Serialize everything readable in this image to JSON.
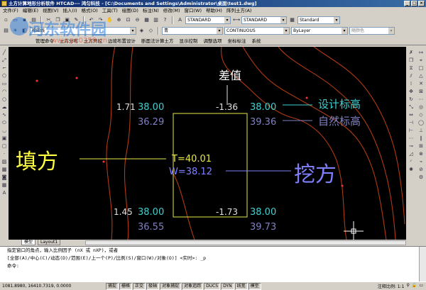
{
  "window": {
    "title": "土方计算地形分析软件 HTCAD--- 鸿匀科技 - [C:\\Documents and Settings\\Administrator\\桌面\\test1.dwg]",
    "controls": [
      "_",
      "□",
      "×"
    ]
  },
  "menu": [
    "文件(F)",
    "编辑(E)",
    "视图(V)",
    "插入(I)",
    "格式(O)",
    "工具(T)",
    "绘图(D)",
    "标注(N)",
    "修改(M)",
    "窗口(W)",
    "帮助(H)",
    "阵列土方(A)"
  ],
  "toolbar": {
    "style_combo": "STANDARD",
    "dim_style_combo": "STANDARD",
    "table_style_combo": "Standard",
    "layer_combo": "梯田线",
    "color_combo": "青",
    "linetype_combo": "CONTINUOUS",
    "lineweight_combo": "ByLayer",
    "plotstyle_combo": "随颜色"
  },
  "custom_menu": [
    "",
    "",
    "",
    "管理命令",
    "土方分布",
    "土方开挖",
    "边坡布置设计",
    "断面法计算土方",
    "显示控制",
    "调整选项",
    "坐标标注",
    "系统"
  ],
  "drawing": {
    "diff_label": "差值",
    "design_elev_label": "设计标高",
    "natural_elev_label": "自然标高",
    "fill_label": "填方",
    "cut_label": "挖方",
    "corner_tl": {
      "diff": "1.71",
      "design": "38.00",
      "natural": "36.29"
    },
    "corner_tr": {
      "diff": "-1.36",
      "design": "38.00",
      "natural": "39.36"
    },
    "corner_bl": {
      "diff": "1.45",
      "design": "38.00",
      "natural": "36.55"
    },
    "corner_br": {
      "diff": "-1.73",
      "design": "38.00",
      "natural": "39.73"
    },
    "t_value": "T=40.01",
    "w_value": "W=38.12"
  },
  "tabs": [
    "模型",
    "Layout1"
  ],
  "command": {
    "line1": "指定窗口的角点，输入比例因子 (nX 或 nXP)，或者",
    "line2": "[全部(A)/中心(C)/动态(D)/范围(E)/上一个(P)/比例(S)/窗口(W)/对象(O)] <实时>: _p",
    "line3": "命令:"
  },
  "status": {
    "coords": "1081.8980, 16410.7319, 0.0000",
    "toggles": [
      "捕捉",
      "栅格",
      "正交",
      "极轴",
      "对象捕捉",
      "对象追踪",
      "DUCS",
      "DYN",
      "线宽",
      "模型"
    ],
    "annotation_scale": "注释比例: 1:1"
  },
  "watermark": {
    "text": "河东软件园",
    "url": "www.pc0359.cn"
  },
  "colors": {
    "canvas_bg": "#000000",
    "contour": "#b03a12",
    "box": "#e8e84a",
    "fill_label": "#ffff40",
    "cut_label": "#8080ff",
    "design": "#40d0d0",
    "natural": "#8080c0",
    "diff": "#e0e0e0"
  }
}
